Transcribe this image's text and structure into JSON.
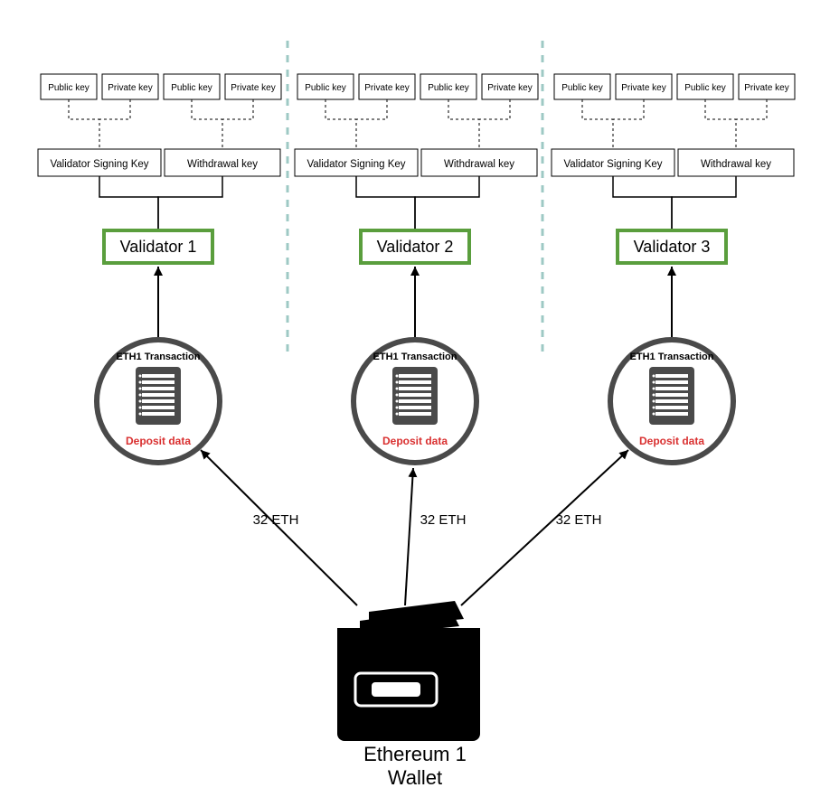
{
  "wallet": {
    "label_line1": "Ethereum 1",
    "label_line2": "Wallet"
  },
  "deposit_amount": "32 ETH",
  "validators": [
    {
      "name": "Validator 1",
      "transaction_label": "ETH1 Transaction",
      "deposit_label": "Deposit data",
      "signing_key_label": "Validator Signing Key",
      "withdrawal_key_label": "Withdrawal key",
      "signing_keys": {
        "public_label": "Public key",
        "private_label": "Private key"
      },
      "withdrawal_keys": {
        "public_label": "Public key",
        "private_label": "Private key"
      }
    },
    {
      "name": "Validator 2",
      "transaction_label": "ETH1 Transaction",
      "deposit_label": "Deposit data",
      "signing_key_label": "Validator Signing Key",
      "withdrawal_key_label": "Withdrawal key",
      "signing_keys": {
        "public_label": "Public key",
        "private_label": "Private key"
      },
      "withdrawal_keys": {
        "public_label": "Public key",
        "private_label": "Private key"
      }
    },
    {
      "name": "Validator 3",
      "transaction_label": "ETH1 Transaction",
      "deposit_label": "Deposit data",
      "signing_key_label": "Validator Signing Key",
      "withdrawal_key_label": "Withdrawal key",
      "signing_keys": {
        "public_label": "Public key",
        "private_label": "Private key"
      },
      "withdrawal_keys": {
        "public_label": "Public key",
        "private_label": "Private key"
      }
    }
  ],
  "colors": {
    "green": "#5a9e3d",
    "red": "#d92f2f",
    "grey": "#4a4a4a",
    "teal": "#9ec9c4"
  }
}
